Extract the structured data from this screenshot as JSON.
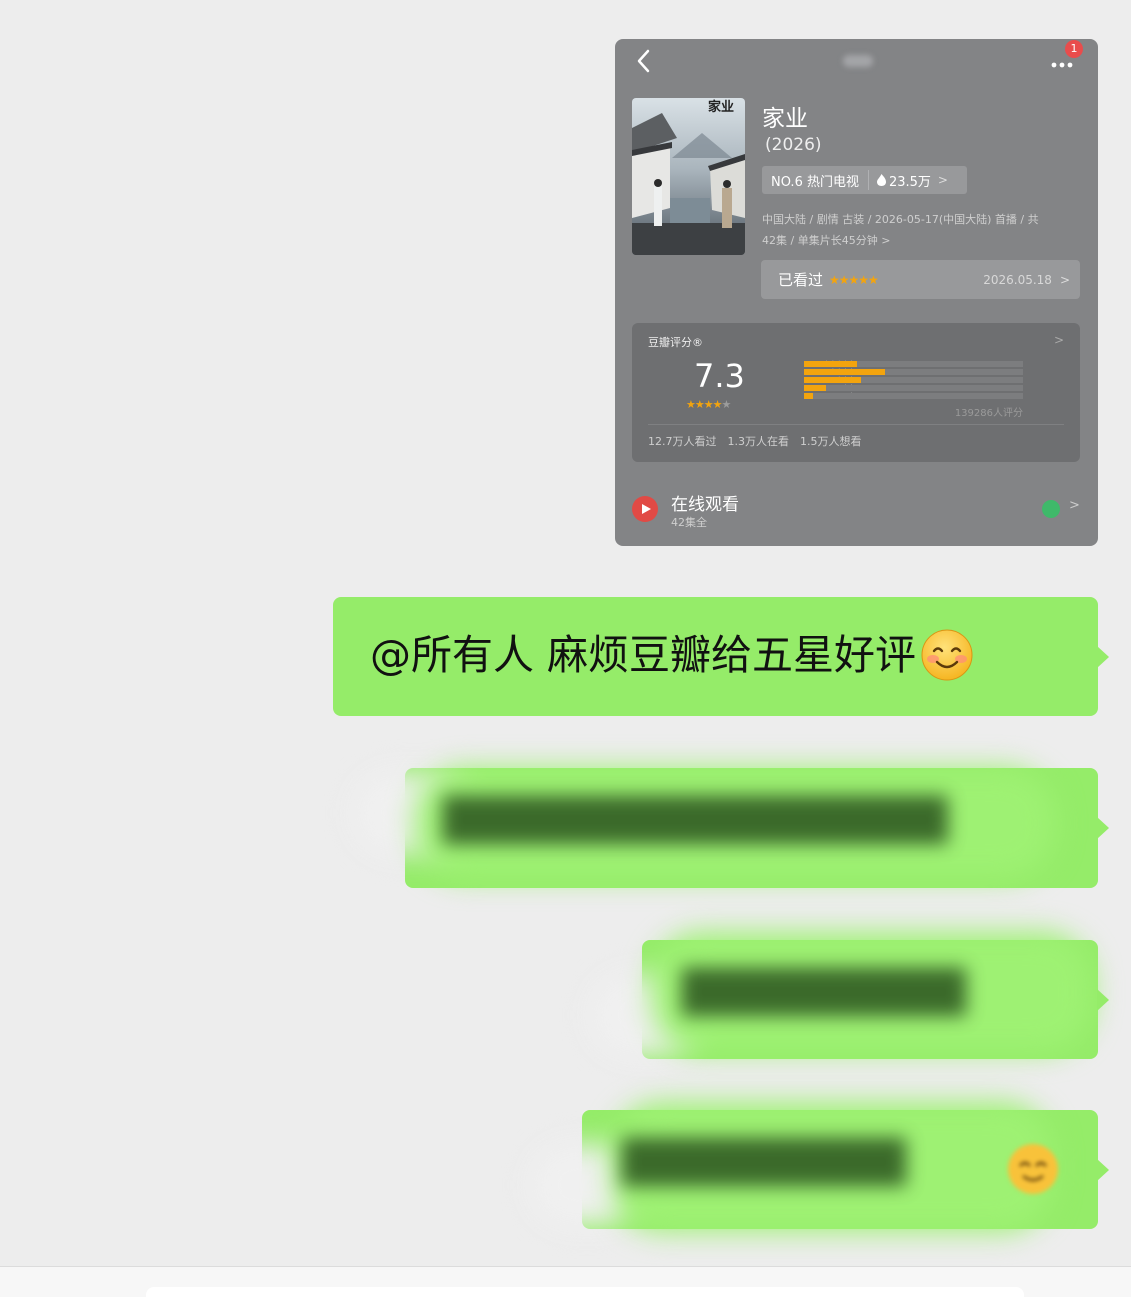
{
  "shared_card": {
    "badge_count": "1",
    "show": {
      "title": "家业",
      "year": "(2026)",
      "rank": "NO.6 热门电视",
      "heat": "23.5万",
      "meta_line1": "中国大陆 / 剧情 古装 / 2026-05-17(中国大陆) 首播 / 共",
      "meta_line2": "42集 / 单集片长45分钟 >"
    },
    "watched": {
      "label": "已看过",
      "stars": "★★★★★",
      "date": "2026.05.18"
    },
    "rating": {
      "label": "豆瓣评分®",
      "score": "7.3",
      "stars_value": 3.5,
      "distribution": [
        {
          "label": "★★★★★",
          "fraction": 0.24
        },
        {
          "label": "★★★★",
          "fraction": 0.37
        },
        {
          "label": "★★★",
          "fraction": 0.26
        },
        {
          "label": "★★",
          "fraction": 0.1
        },
        {
          "label": "★",
          "fraction": 0.04
        }
      ],
      "count": "139286人评分",
      "stats": [
        "12.7万人看过",
        "1.3万人在看",
        "1.5万人想看"
      ]
    },
    "online": {
      "title": "在线观看",
      "subtitle": "42集全"
    }
  },
  "messages": [
    {
      "text": "@所有人 麻烦豆瓣给五星好评",
      "emoji": "smiling-face-icon"
    }
  ],
  "colors": {
    "bubble": "#95ec69",
    "background": "#ededed",
    "card": "#838486",
    "accent_star": "#f3a40e"
  }
}
